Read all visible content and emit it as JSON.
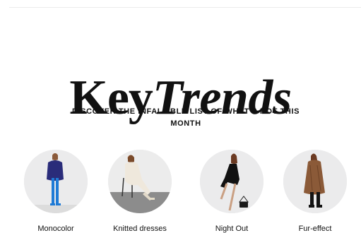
{
  "page": {
    "title_regular": "Key",
    "title_italic": "Trends",
    "subtitle": "DISCOVER THE INFALLIBLE LIST OF WHAT'S HOT THIS MONTH"
  },
  "categories": [
    {
      "label": "Monocolor",
      "image": "woman-blue-outfit-photo"
    },
    {
      "label": "Knitted dresses",
      "image": "woman-knit-dress-seated-photo"
    },
    {
      "label": "Night Out",
      "image": "woman-black-dress-photo"
    },
    {
      "label": "Fur-effect",
      "image": "woman-brown-fur-coat-photo"
    }
  ],
  "colors": {
    "text": "#111111",
    "circle_background": "#e9e9ea",
    "divider": "#ececec"
  }
}
